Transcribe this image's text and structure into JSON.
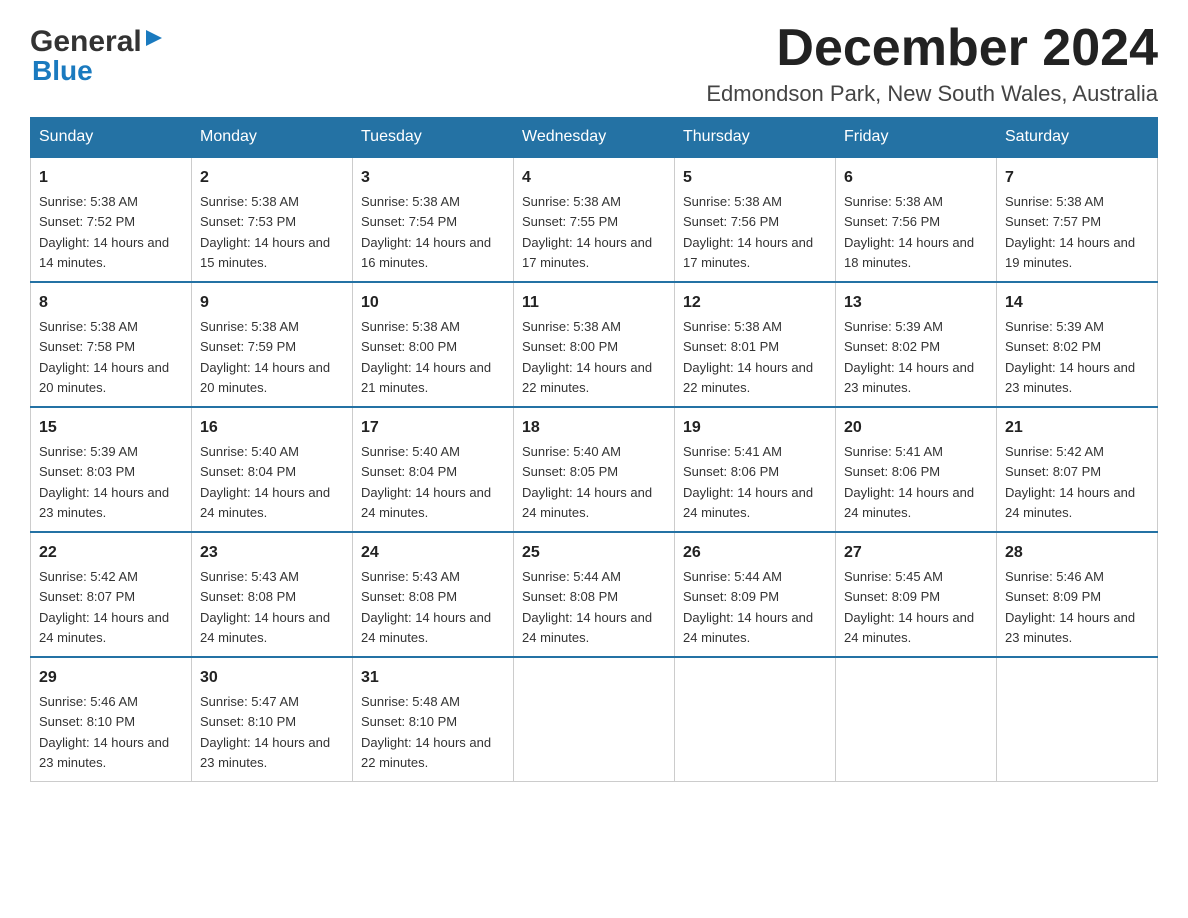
{
  "logo": {
    "general": "General",
    "blue": "Blue"
  },
  "header": {
    "month_year": "December 2024",
    "location": "Edmondson Park, New South Wales, Australia"
  },
  "weekdays": [
    "Sunday",
    "Monday",
    "Tuesday",
    "Wednesday",
    "Thursday",
    "Friday",
    "Saturday"
  ],
  "weeks": [
    [
      {
        "day": "1",
        "sunrise": "5:38 AM",
        "sunset": "7:52 PM",
        "daylight": "14 hours and 14 minutes."
      },
      {
        "day": "2",
        "sunrise": "5:38 AM",
        "sunset": "7:53 PM",
        "daylight": "14 hours and 15 minutes."
      },
      {
        "day": "3",
        "sunrise": "5:38 AM",
        "sunset": "7:54 PM",
        "daylight": "14 hours and 16 minutes."
      },
      {
        "day": "4",
        "sunrise": "5:38 AM",
        "sunset": "7:55 PM",
        "daylight": "14 hours and 17 minutes."
      },
      {
        "day": "5",
        "sunrise": "5:38 AM",
        "sunset": "7:56 PM",
        "daylight": "14 hours and 17 minutes."
      },
      {
        "day": "6",
        "sunrise": "5:38 AM",
        "sunset": "7:56 PM",
        "daylight": "14 hours and 18 minutes."
      },
      {
        "day": "7",
        "sunrise": "5:38 AM",
        "sunset": "7:57 PM",
        "daylight": "14 hours and 19 minutes."
      }
    ],
    [
      {
        "day": "8",
        "sunrise": "5:38 AM",
        "sunset": "7:58 PM",
        "daylight": "14 hours and 20 minutes."
      },
      {
        "day": "9",
        "sunrise": "5:38 AM",
        "sunset": "7:59 PM",
        "daylight": "14 hours and 20 minutes."
      },
      {
        "day": "10",
        "sunrise": "5:38 AM",
        "sunset": "8:00 PM",
        "daylight": "14 hours and 21 minutes."
      },
      {
        "day": "11",
        "sunrise": "5:38 AM",
        "sunset": "8:00 PM",
        "daylight": "14 hours and 22 minutes."
      },
      {
        "day": "12",
        "sunrise": "5:38 AM",
        "sunset": "8:01 PM",
        "daylight": "14 hours and 22 minutes."
      },
      {
        "day": "13",
        "sunrise": "5:39 AM",
        "sunset": "8:02 PM",
        "daylight": "14 hours and 23 minutes."
      },
      {
        "day": "14",
        "sunrise": "5:39 AM",
        "sunset": "8:02 PM",
        "daylight": "14 hours and 23 minutes."
      }
    ],
    [
      {
        "day": "15",
        "sunrise": "5:39 AM",
        "sunset": "8:03 PM",
        "daylight": "14 hours and 23 minutes."
      },
      {
        "day": "16",
        "sunrise": "5:40 AM",
        "sunset": "8:04 PM",
        "daylight": "14 hours and 24 minutes."
      },
      {
        "day": "17",
        "sunrise": "5:40 AM",
        "sunset": "8:04 PM",
        "daylight": "14 hours and 24 minutes."
      },
      {
        "day": "18",
        "sunrise": "5:40 AM",
        "sunset": "8:05 PM",
        "daylight": "14 hours and 24 minutes."
      },
      {
        "day": "19",
        "sunrise": "5:41 AM",
        "sunset": "8:06 PM",
        "daylight": "14 hours and 24 minutes."
      },
      {
        "day": "20",
        "sunrise": "5:41 AM",
        "sunset": "8:06 PM",
        "daylight": "14 hours and 24 minutes."
      },
      {
        "day": "21",
        "sunrise": "5:42 AM",
        "sunset": "8:07 PM",
        "daylight": "14 hours and 24 minutes."
      }
    ],
    [
      {
        "day": "22",
        "sunrise": "5:42 AM",
        "sunset": "8:07 PM",
        "daylight": "14 hours and 24 minutes."
      },
      {
        "day": "23",
        "sunrise": "5:43 AM",
        "sunset": "8:08 PM",
        "daylight": "14 hours and 24 minutes."
      },
      {
        "day": "24",
        "sunrise": "5:43 AM",
        "sunset": "8:08 PM",
        "daylight": "14 hours and 24 minutes."
      },
      {
        "day": "25",
        "sunrise": "5:44 AM",
        "sunset": "8:08 PM",
        "daylight": "14 hours and 24 minutes."
      },
      {
        "day": "26",
        "sunrise": "5:44 AM",
        "sunset": "8:09 PM",
        "daylight": "14 hours and 24 minutes."
      },
      {
        "day": "27",
        "sunrise": "5:45 AM",
        "sunset": "8:09 PM",
        "daylight": "14 hours and 24 minutes."
      },
      {
        "day": "28",
        "sunrise": "5:46 AM",
        "sunset": "8:09 PM",
        "daylight": "14 hours and 23 minutes."
      }
    ],
    [
      {
        "day": "29",
        "sunrise": "5:46 AM",
        "sunset": "8:10 PM",
        "daylight": "14 hours and 23 minutes."
      },
      {
        "day": "30",
        "sunrise": "5:47 AM",
        "sunset": "8:10 PM",
        "daylight": "14 hours and 23 minutes."
      },
      {
        "day": "31",
        "sunrise": "5:48 AM",
        "sunset": "8:10 PM",
        "daylight": "14 hours and 22 minutes."
      },
      null,
      null,
      null,
      null
    ]
  ],
  "labels": {
    "sunrise": "Sunrise:",
    "sunset": "Sunset:",
    "daylight": "Daylight:"
  }
}
